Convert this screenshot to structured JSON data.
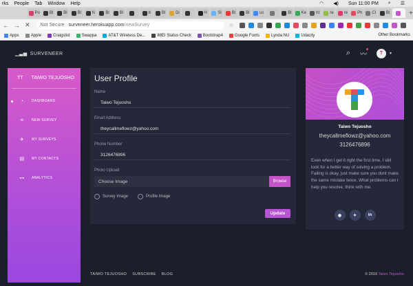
{
  "os_menu": {
    "items": [
      "rks",
      "People",
      "Tab",
      "Window",
      "Help"
    ],
    "time": "Sun 11:00 PM"
  },
  "browser": {
    "tabs": [
      {
        "label": "Po",
        "color": "#d93b6b"
      },
      {
        "label": "Bl",
        "color": "#333333"
      },
      {
        "label": "Bl",
        "color": "#333333"
      },
      {
        "label": "Bl",
        "color": "#333333"
      },
      {
        "label": "N",
        "color": "#333333"
      },
      {
        "label": "Bl",
        "color": "#333333"
      },
      {
        "label": "Bl",
        "color": "#333333"
      },
      {
        "label": "",
        "color": "#333333"
      },
      {
        "label": "b",
        "color": "#333333"
      },
      {
        "label": "Bl",
        "color": "#333333"
      },
      {
        "label": "Di",
        "color": "#e0a42e"
      },
      {
        "label": "",
        "color": "#333333"
      },
      {
        "label": "H",
        "color": "#222222"
      },
      {
        "label": "Sl",
        "color": "#66b2ff"
      },
      {
        "label": "Bl",
        "color": "#e53935"
      },
      {
        "label": "Bl",
        "color": "#333333"
      },
      {
        "label": "us",
        "color": "#4285f4"
      },
      {
        "label": "",
        "color": "#777777"
      },
      {
        "label": "Bl",
        "color": "#333333"
      },
      {
        "label": "Ke",
        "color": "#34a853"
      },
      {
        "label": "ht",
        "color": "#555555"
      },
      {
        "label": "re",
        "color": "#8fbf3f"
      },
      {
        "label": "re",
        "color": "#d93b6b"
      },
      {
        "label": "Ph",
        "color": "#e84a5f"
      },
      {
        "label": "Cl",
        "color": "#777777"
      },
      {
        "label": "Bl",
        "color": "#333333"
      },
      {
        "label": "",
        "color": "#c455c8"
      }
    ],
    "url_security": "Not Secure",
    "url_host": "surveneer.herokuapp.com",
    "url_path": "/newSurvey",
    "bookmarks": [
      {
        "label": "Apps",
        "color": "#4285f4"
      },
      {
        "label": "Apple",
        "color": "#888888"
      },
      {
        "label": "Craigslist",
        "color": "#7b3ab8"
      },
      {
        "label": "Swappa",
        "color": "#3cb371"
      },
      {
        "label": "AT&T Wireless De...",
        "color": "#00a8e0"
      },
      {
        "label": "IMEI Status Check",
        "color": "#444444"
      },
      {
        "label": "Bootstrap4",
        "color": "#7952b3"
      },
      {
        "label": "Google Fonts",
        "color": "#ea4335"
      },
      {
        "label": "Lynda NU",
        "color": "#f4b400"
      },
      {
        "label": "Udacity",
        "color": "#02b3e4"
      }
    ],
    "bookmarks_other": "Other Bookmarks"
  },
  "header": {
    "brand": "SURVENEER",
    "avatar_initial": "T"
  },
  "sidebar": {
    "initials": "TT",
    "name": "TAIWO TEJUOSHO",
    "items": [
      {
        "label": "DASHBOARD",
        "icon": "◔"
      },
      {
        "label": "NEW SURVEY",
        "icon": "⚛"
      },
      {
        "label": "MY SURVEYS",
        "icon": "✈"
      },
      {
        "label": "MY CONTACTS",
        "icon": "▤"
      },
      {
        "label": "ANALYTICS",
        "icon": "⊶"
      }
    ]
  },
  "profile": {
    "title": "User Profile",
    "name_label": "Name",
    "name_value": "Taiwo Tejuosho",
    "email_label": "Email Address",
    "email_value": "theycallmeflowz@yahoo.com",
    "phone_label": "Phone Number",
    "phone_value": "3126476896",
    "upload_label": "Photo Upload",
    "upload_placeholder": "Choose Image",
    "browse_label": "Browse",
    "radio_survey": "Survey Image",
    "radio_profile": "Profile Image",
    "update_label": "Update"
  },
  "user_card": {
    "name": "Taiwo Tejuosho",
    "email": "theycallmeflowz@yahoo.com",
    "phone": "3126476896",
    "bio": "Even when I get it right the first time, I still look for a better way of solving a problem. Failing is okay, just make sure you dont make the same mistake twice. What problems can I help you resolve, think with me.",
    "socials": [
      {
        "icon": "github-icon",
        "glyph": "◉"
      },
      {
        "icon": "twitter-icon",
        "glyph": "✦"
      },
      {
        "icon": "linkedin-icon",
        "glyph": "in"
      }
    ]
  },
  "footer": {
    "links": [
      "TAIWO TEJUOSHO",
      "SUBSCRIBE",
      "BLOG"
    ],
    "copyright_prefix": "© 2019",
    "copyright_name": "Taiwo Tejuosho"
  },
  "colors": {
    "accent": "#c455c8",
    "background": "#1b1e2b",
    "card": "#252838"
  }
}
